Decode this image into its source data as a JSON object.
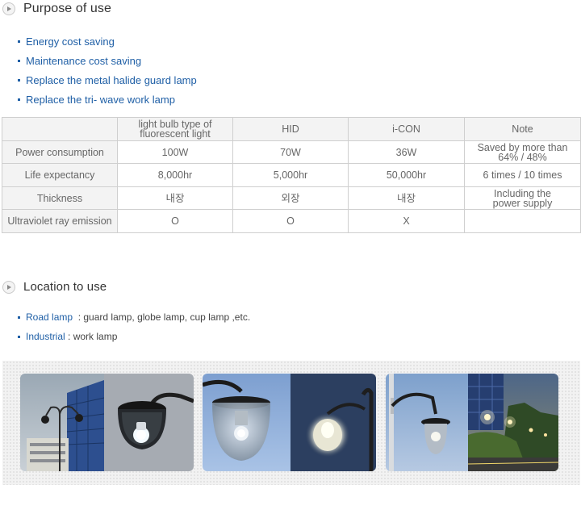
{
  "purpose": {
    "title": "Purpose of use",
    "items": [
      "Energy cost saving",
      "Maintenance cost saving",
      "Replace the metal halide guard lamp",
      "Replace the tri- wave work lamp"
    ]
  },
  "table": {
    "headers": [
      "",
      "light bulb type of fluorescent light",
      "HID",
      "i-CON",
      "Note"
    ],
    "rows": [
      [
        "Power consumption",
        "100W",
        "70W",
        "36W",
        "Saved by more than 64% / 48%"
      ],
      [
        "Life expectancy",
        "8,000hr",
        "5,000hr",
        "50,000hr",
        "6 times / 10 times"
      ],
      [
        "Thickness",
        "내장",
        "외장",
        "내장",
        "Including the power supply"
      ],
      [
        "Ultraviolet ray emission",
        "O",
        "O",
        "X",
        ""
      ]
    ]
  },
  "location": {
    "title": "Location to use",
    "items": [
      {
        "key": "Road lamp",
        "sep": "  : ",
        "value": "guard lamp, globe lamp, cup lamp ,etc."
      },
      {
        "key": "Industrial",
        "sep": " : ",
        "value": "work lamp"
      }
    ]
  },
  "icons": {
    "section_bullet": "play-circle-icon",
    "list_bullet": "square-bullet-icon"
  },
  "colors": {
    "accent_blue": "#1f5fa6",
    "table_border": "#cfcfcf",
    "table_header_bg": "#f3f3f3"
  }
}
